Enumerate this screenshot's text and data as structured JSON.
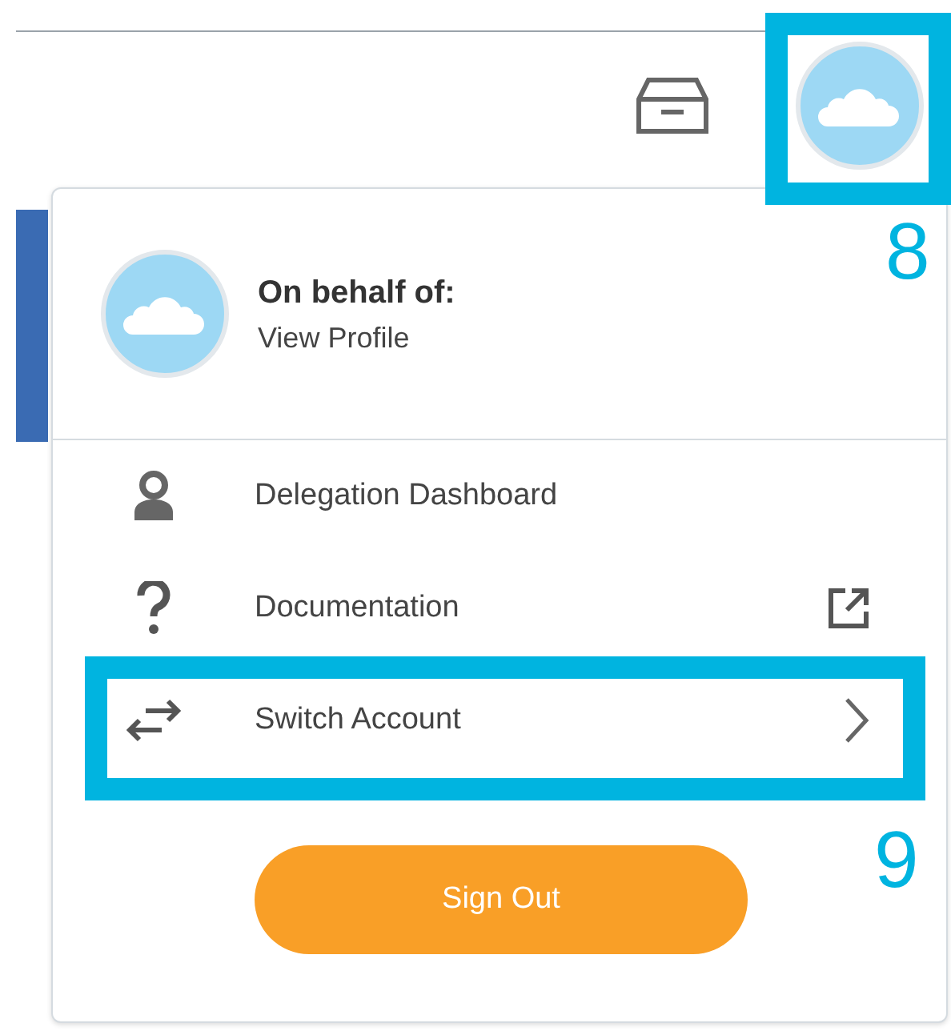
{
  "profile_menu": {
    "header_title": "On behalf of:",
    "header_link": "View Profile",
    "items": [
      {
        "kind": "person",
        "label": "Delegation Dashboard"
      },
      {
        "kind": "help",
        "label": "Documentation",
        "external_link": true
      },
      {
        "kind": "switch",
        "label": "Switch Account",
        "has_submenu": true
      }
    ],
    "sign_out": "Sign Out"
  },
  "annotations": [
    {
      "label": "8"
    },
    {
      "label": "9"
    }
  ]
}
